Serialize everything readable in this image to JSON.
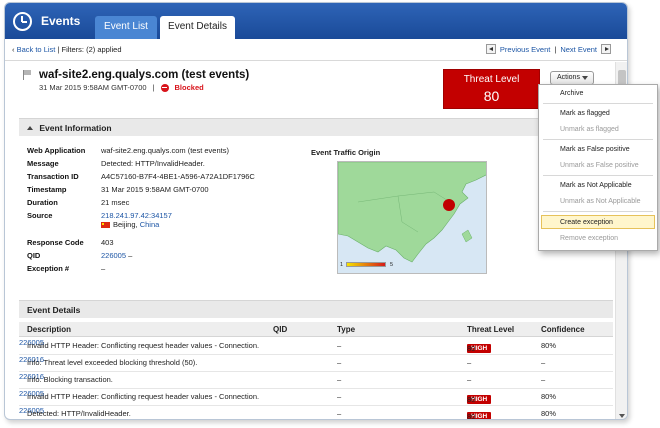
{
  "header": {
    "title": "Events",
    "tabs": [
      {
        "label": "Event List"
      },
      {
        "label": "Event Details"
      }
    ]
  },
  "subbar": {
    "back_label": "Back to List",
    "filters_label": "| Filters: (2) applied",
    "previous_label": "Previous Event",
    "separator": "|",
    "next_label": "Next Event"
  },
  "event": {
    "title": "waf-site2.eng.qualys.com (test events)",
    "date": "31 Mar 2015 9:58AM GMT-0700",
    "separator": "|",
    "status": "Blocked"
  },
  "threat": {
    "label": "Threat Level",
    "value": "80"
  },
  "actions": {
    "label": "Actions",
    "menu": [
      {
        "label": "Archive",
        "enabled": true
      },
      {
        "label": "Mark as flagged",
        "enabled": true
      },
      {
        "label": "Unmark as flagged",
        "enabled": false
      },
      {
        "label": "Mark as False positive",
        "enabled": true
      },
      {
        "label": "Unmark as False positive",
        "enabled": false
      },
      {
        "label": "Mark as Not Applicable",
        "enabled": true
      },
      {
        "label": "Unmark as Not Applicable",
        "enabled": false
      },
      {
        "label": "Create exception",
        "enabled": true,
        "highlighted": true
      },
      {
        "label": "Remove exception",
        "enabled": false
      }
    ]
  },
  "event_information": {
    "heading": "Event Information",
    "fields": {
      "web_application": {
        "label": "Web Application",
        "value": "waf-site2.eng.qualys.com (test events)"
      },
      "message": {
        "label": "Message",
        "value": "Detected: HTTP/InvalidHeader."
      },
      "transaction_id": {
        "label": "Transaction ID",
        "value": "A4C57160-B7F4-4BE1-A596-A72A1DF1796C"
      },
      "timestamp": {
        "label": "Timestamp",
        "value": "31 Mar 2015 9:58AM GMT-0700"
      },
      "duration": {
        "label": "Duration",
        "value": "21 msec"
      },
      "source": {
        "label": "Source",
        "value": "218.241.97.42:34157",
        "location_city": "Beijing,",
        "location_country": "China"
      },
      "response_code": {
        "label": "Response Code",
        "value": "403"
      },
      "qid": {
        "label": "QID",
        "value": "226005",
        "extra": "–"
      },
      "exception": {
        "label": "Exception #",
        "value": "–"
      }
    },
    "map": {
      "title": "Event Traffic Origin",
      "legend_min": "1",
      "legend_max": "5",
      "colors": {
        "land": "#9fd99a",
        "water": "#d7e7f4",
        "marker": "#c10000"
      }
    }
  },
  "event_details": {
    "heading": "Event Details",
    "columns": {
      "description": "Description",
      "qid": "QID",
      "type": "Type",
      "threat": "Threat Level",
      "confidence": "Confidence"
    },
    "rows": [
      {
        "description": "Invalid HTTP Header: Conflicting request header values - Connection.",
        "qid": "226005",
        "type": "–",
        "badge": "HIGH",
        "threat": "80",
        "confidence": "80%"
      },
      {
        "description": "Info: Threat level exceeded blocking threshold (50).",
        "qid": "226016",
        "type": "–",
        "badge": "",
        "threat": "–",
        "confidence": "–"
      },
      {
        "description": "Info: Blocking transaction.",
        "qid": "226016",
        "type": "–",
        "badge": "",
        "threat": "–",
        "confidence": "–"
      },
      {
        "description": "Invalid HTTP Header: Conflicting request header values - Connection.",
        "qid": "226005",
        "type": "–",
        "badge": "HIGH",
        "threat": "80",
        "confidence": "80%"
      },
      {
        "description": "Detected: HTTP/InvalidHeader.",
        "qid": "226005",
        "type": "–",
        "badge": "HIGH",
        "threat": "80",
        "confidence": "80%"
      }
    ]
  }
}
